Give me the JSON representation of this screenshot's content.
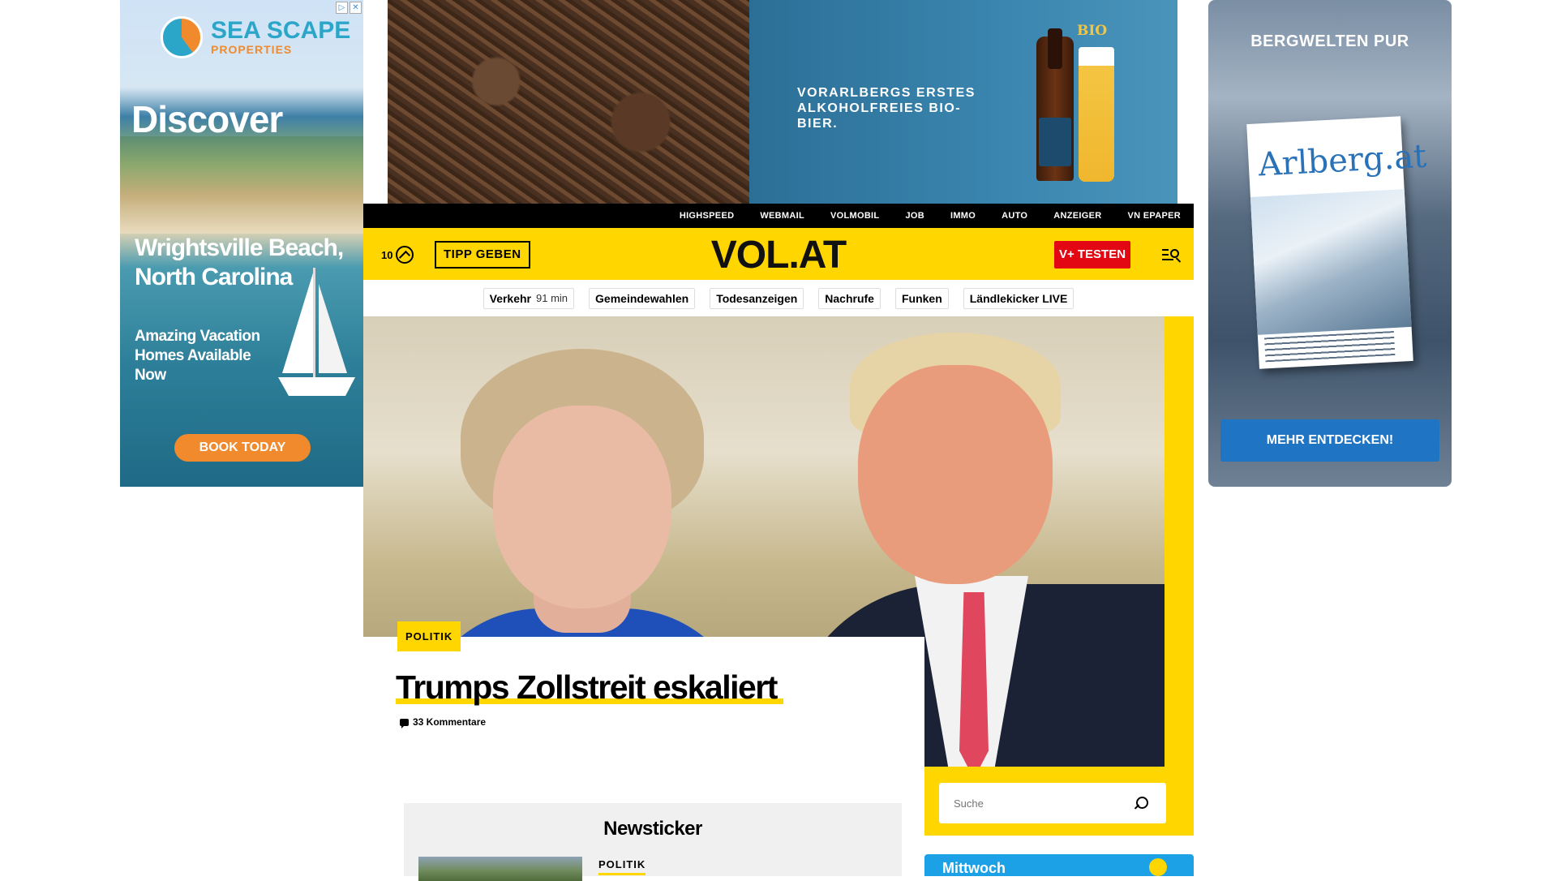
{
  "ads": {
    "left": {
      "brand": "SEA SCAPE",
      "brand_sub": "PROPERTIES",
      "headline": "Discover",
      "location": "Wrightsville Beach, North Carolina",
      "tagline": "Amazing Vacation Homes Available Now",
      "cta": "BOOK TODAY"
    },
    "top": {
      "text": "VORARLBERGS ERSTES ALKOHOLFREIES BIO-BIER.",
      "badge": "BIO"
    },
    "right": {
      "heading": "BERGWELTEN PUR",
      "magazine_title": "Arlberg.at",
      "cta": "MEHR ENTDECKEN!"
    }
  },
  "topnav": [
    "HIGHSPEED",
    "WEBMAIL",
    "VOLMOBIL",
    "JOB",
    "IMMO",
    "AUTO",
    "ANZEIGER",
    "VN EPAPER"
  ],
  "header": {
    "temperature": "10",
    "tipp_label": "TIPP GEBEN",
    "logo": "VOL.AT",
    "vplus_label": "V+ TESTEN"
  },
  "quicklinks": [
    {
      "label": "Verkehr",
      "sub": "91 min"
    },
    {
      "label": "Gemeindewahlen",
      "sub": ""
    },
    {
      "label": "Todesanzeigen",
      "sub": ""
    },
    {
      "label": "Nachrufe",
      "sub": ""
    },
    {
      "label": "Funken",
      "sub": ""
    },
    {
      "label": "Ländlekicker LIVE",
      "sub": ""
    }
  ],
  "hero": {
    "category": "POLITIK",
    "headline": "Trumps Zollstreit eskaliert",
    "comments": "33 Kommentare"
  },
  "search": {
    "placeholder": "Suche"
  },
  "newsticker": {
    "title": "Newsticker",
    "first_category": "POLITIK"
  },
  "weather_widget": {
    "day": "Mittwoch"
  },
  "colors": {
    "brand_yellow": "#ffd600",
    "vplus_red": "#e30613",
    "ticker_bg": "#f0f0f0"
  }
}
